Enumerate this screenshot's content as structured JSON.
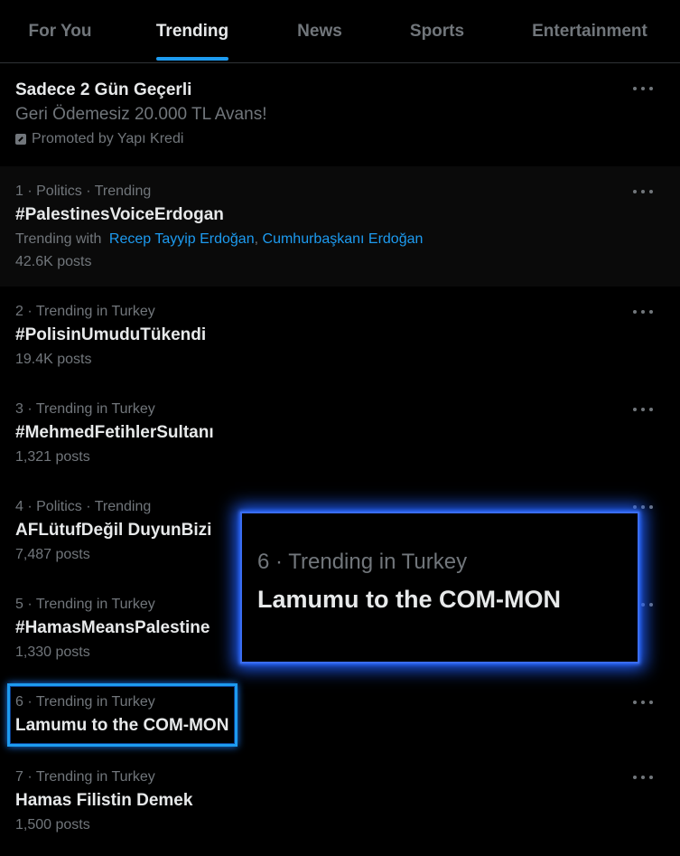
{
  "tabs": [
    {
      "label": "For You"
    },
    {
      "label": "Trending"
    },
    {
      "label": "News"
    },
    {
      "label": "Sports"
    },
    {
      "label": "Entertainment"
    }
  ],
  "active_tab": "Trending",
  "promo": {
    "title": "Sadece 2 Gün Geçerli",
    "subtitle": "Geri Ödemesiz 20.000 TL Avans!",
    "promoted_label": "Promoted by Yapı Kredi"
  },
  "trends": [
    {
      "meta": "1 · Politics · Trending",
      "title": "#PalestinesVoiceErdogan",
      "with_label": "Trending with",
      "with_links": [
        "Recep Tayyip Erdoğan",
        "Cumhurbaşkanı Erdoğan"
      ],
      "link_sep": ",",
      "count": "42.6K posts"
    },
    {
      "meta": "2 · Trending in Turkey",
      "title": "#PolisinUmuduTükendi",
      "count": "19.4K posts"
    },
    {
      "meta": "3 · Trending in Turkey",
      "title": "#MehmedFetihlerSultanı",
      "count": "1,321 posts"
    },
    {
      "meta": "4 · Politics · Trending",
      "title": "AFLütufDeğil DuyunBizi",
      "count": "7,487 posts"
    },
    {
      "meta": "5 · Trending in Turkey",
      "title": "#HamasMeansPalestine",
      "count": "1,330 posts"
    },
    {
      "meta": "6 · Trending in Turkey",
      "title": "Lamumu to the COM-MON",
      "count": ""
    },
    {
      "meta": "7 · Trending in Turkey",
      "title": "Hamas Filistin Demek",
      "count": "1,500 posts"
    }
  ],
  "zoom": {
    "meta": "6 · Trending in Turkey",
    "title": "Lamumu to the COM-MON"
  },
  "colors": {
    "accent": "#1d9bf0",
    "background": "#000000",
    "text_primary": "#e7e9ea",
    "text_secondary": "#71767b"
  }
}
